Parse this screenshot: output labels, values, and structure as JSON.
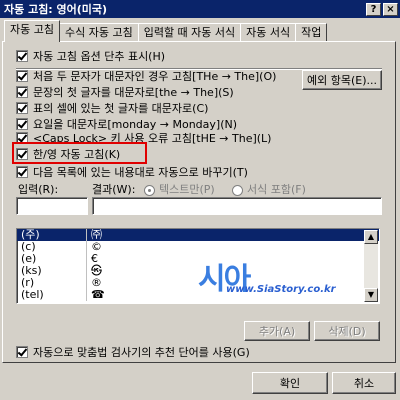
{
  "window": {
    "title": "자동 고침: 영어(미국)",
    "help_label": "?",
    "close_label": "×"
  },
  "tabs": [
    {
      "label": "자동 고침"
    },
    {
      "label": "수식 자동 고침"
    },
    {
      "label": "입력할 때 자동 서식"
    },
    {
      "label": "자동 서식"
    },
    {
      "label": "작업"
    }
  ],
  "options": {
    "show_buttons": "자동 고침 옵션 단추 표시(H)",
    "two_initial_caps": "처음 두 문자가 대문자인 경우 고침[THe → The](O)",
    "first_letter_sentences": "문장의 첫 글자를 대문자로[the → The](S)",
    "first_letter_table_cells": "표의 셀에 있는 첫 글자를 대문자로(C)",
    "capitalize_days": "요일을 대문자로[monday → Monday](N)",
    "caps_lock": "<Caps Lock> 키 사용 오류 고침[tHE → The](L)",
    "han_eng": "한/영 자동 고침(K)",
    "replace_as_you_type": "다음 목록에 있는 내용대로 자동으로 바꾸기(T)"
  },
  "buttons": {
    "exceptions": "예외 항목(E)...",
    "add": "추가(A)",
    "delete": "삭제(D)",
    "ok": "확인",
    "cancel": "취소"
  },
  "replace": {
    "input_label": "입력(R):",
    "result_label": "결과(W):",
    "plain_text": "텍스트만(P)",
    "formatted_text": "서식 포함(F)"
  },
  "list_rows": [
    {
      "input": "(주)",
      "result": "㈜"
    },
    {
      "input": "(c)",
      "result": "©"
    },
    {
      "input": "(e)",
      "result": "€"
    },
    {
      "input": "(ks)",
      "result": "㉿"
    },
    {
      "input": "(r)",
      "result": "®"
    },
    {
      "input": "(tel)",
      "result": "☎"
    }
  ],
  "suggest": "자동으로 맞춤법 검사기의 추천 단어를 사용(G)",
  "watermark": {
    "big": "시아",
    "small": "www.SiaStory.co.kr"
  },
  "colors": {
    "titlebar": "#0a246a",
    "highlight": "#e00000"
  }
}
